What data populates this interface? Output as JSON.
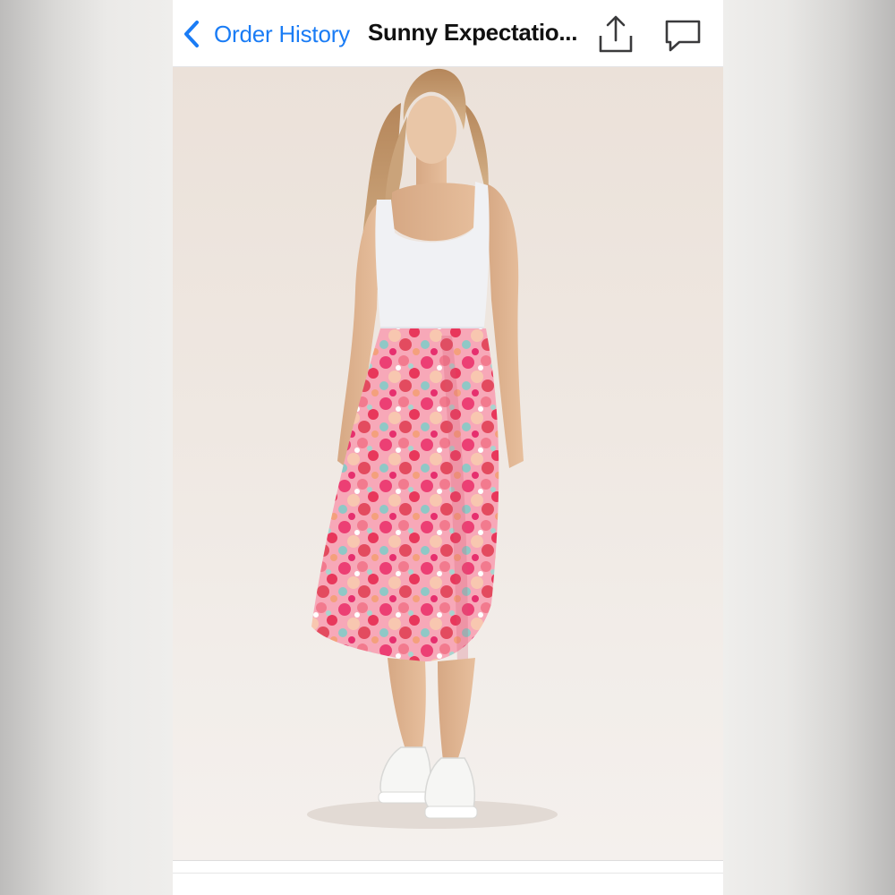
{
  "navbar": {
    "back_label": "Order History",
    "title": "Sunny Expectatio...",
    "share_icon": "share-icon",
    "comment_icon": "comment-icon"
  },
  "photo": {
    "subject": "product-photo"
  },
  "colors": {
    "accent": "#1a7cf5",
    "title": "#111111"
  }
}
